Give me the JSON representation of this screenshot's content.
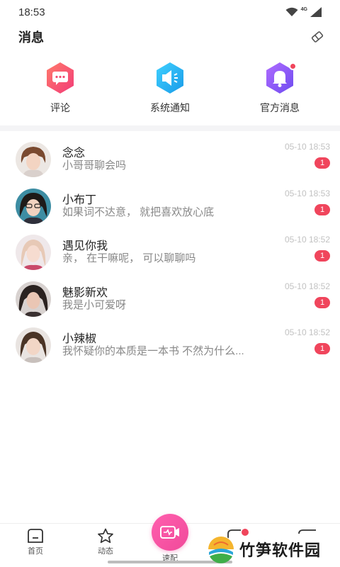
{
  "status_bar": {
    "time": "18:53",
    "network": "4G"
  },
  "header": {
    "title": "消息"
  },
  "shortcuts": [
    {
      "label": "评论",
      "icon": "comment-icon",
      "color": "#f54a6e"
    },
    {
      "label": "系统通知",
      "icon": "speaker-icon",
      "color": "#27b4f2"
    },
    {
      "label": "官方消息",
      "icon": "bell-icon",
      "color": "#8b5cf6"
    }
  ],
  "conversations": [
    {
      "name": "念念",
      "preview": "小哥哥聊会吗",
      "time": "05-10 18:53",
      "unread": "1"
    },
    {
      "name": "小布丁",
      "preview": "如果词不达意， 就把喜欢放心底",
      "time": "05-10 18:53",
      "unread": "1"
    },
    {
      "name": "遇见你我",
      "preview": "亲， 在干嘛呢， 可以聊聊吗",
      "time": "05-10 18:52",
      "unread": "1"
    },
    {
      "name": "魅影新欢",
      "preview": "我是小可爱呀",
      "time": "05-10 18:52",
      "unread": "1"
    },
    {
      "name": "小辣椒",
      "preview": "我怀疑你的本质是一本书 不然为什么...",
      "time": "05-10 18:52",
      "unread": "1"
    }
  ],
  "tabbar": {
    "home": "首页",
    "moments": "动态",
    "match": "速配"
  },
  "watermark": {
    "text": "竹笋软件园"
  },
  "colors": {
    "accent_pink": "#f04a9a",
    "badge_red": "#f0455c"
  }
}
